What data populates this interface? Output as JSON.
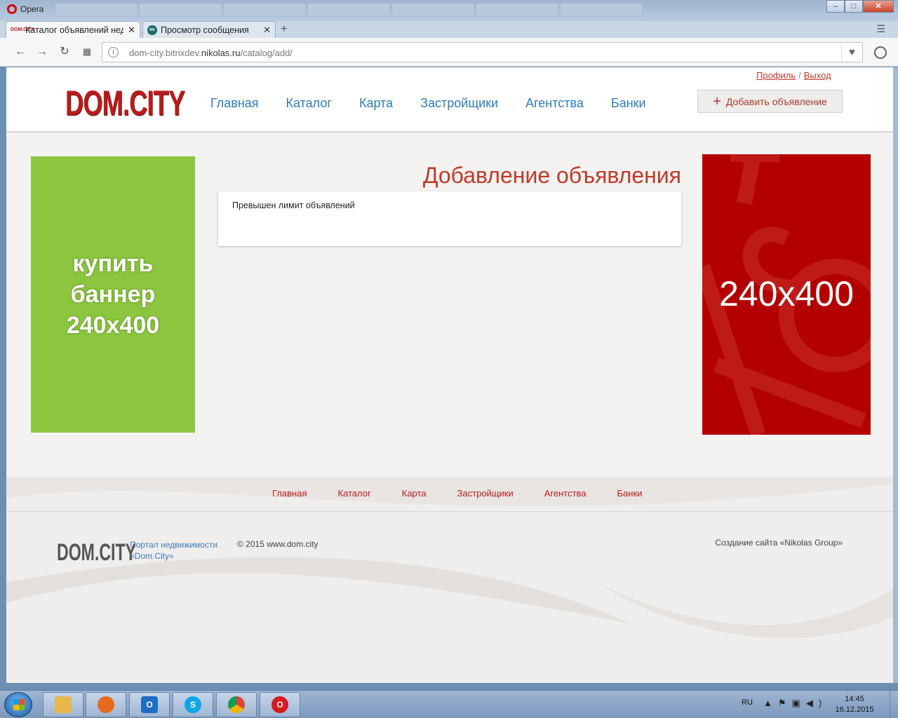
{
  "browser": {
    "app_name": "Opera",
    "ghost_tabs": [
      "",
      "",
      "",
      "",
      "",
      "",
      ""
    ],
    "tabs": [
      {
        "title": "Каталог объявлений недв",
        "favicon": "DOM.CITY",
        "active": true
      },
      {
        "title": "Просмотр сообщения",
        "favicon": "ec",
        "active": false
      }
    ],
    "window_controls": {
      "minimize": "–",
      "maximize": "□",
      "close": "✕"
    },
    "new_tab_icon": "+",
    "url_host": "dom-city.bitrixdev.",
    "url_domain": "nikolas.ru",
    "url_path": "/catalog/add/"
  },
  "site": {
    "logo": "DOM.CITY",
    "top_links": {
      "profile": "Профиль",
      "separator": "/",
      "logout": "Выход"
    },
    "nav": [
      "Главная",
      "Каталог",
      "Карта",
      "Застройщики",
      "Агентства",
      "Банки"
    ],
    "add_button": {
      "icon": "+",
      "label": "Добавить объявление"
    },
    "page_title": "Добавление объявления",
    "message": "Превышен лимит объявлений",
    "banner_left_text": "купить\nбаннер\n240x400",
    "banner_right_text": "240x400",
    "colors": {
      "brand_red": "#b71c1c",
      "link_blue": "#2d7cc0",
      "banner_green": "#8cc63f",
      "banner_red": "#b30000"
    }
  },
  "footer": {
    "nav": [
      "Главная",
      "Каталог",
      "Карта",
      "Застройщики",
      "Агентства",
      "Банки"
    ],
    "logo": "DOM.CITY",
    "portal_text": "Портал недвижимости\n«Dom.City»",
    "copyright": "© 2015 www.dom.city",
    "credit": "Создание сайта «Nikolas Group»"
  },
  "taskbar": {
    "apps": [
      {
        "name": "explorer",
        "label": "",
        "color": "#e8b84a"
      },
      {
        "name": "firefox",
        "label": "",
        "color": "#e66a1f"
      },
      {
        "name": "outlook",
        "label": "O",
        "color": "#1f6dbf"
      },
      {
        "name": "skype",
        "label": "S",
        "color": "#10a5e8"
      },
      {
        "name": "chrome",
        "label": "",
        "color": "#3aa757"
      },
      {
        "name": "opera",
        "label": "O",
        "color": "#d71920"
      }
    ],
    "language": "RU",
    "time": "14:45",
    "date": "16.12.2015"
  }
}
